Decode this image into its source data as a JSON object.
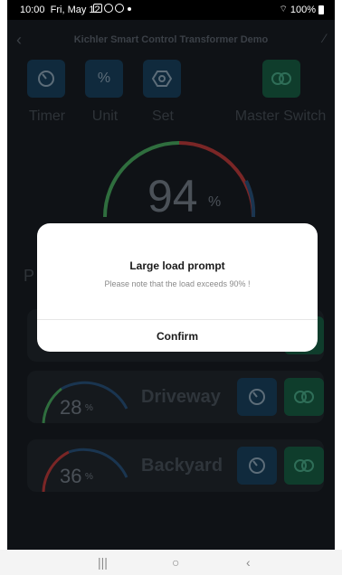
{
  "status_bar": {
    "time": "10:00",
    "date": "Fri, May 12",
    "battery": "100%"
  },
  "header": {
    "title": "Kichler Smart Control Transformer Demo"
  },
  "functions": [
    {
      "label": "Timer",
      "icon": "timer-icon"
    },
    {
      "label": "Unit",
      "icon": "percent-icon"
    },
    {
      "label": "Set",
      "icon": "hexagon-settings-icon"
    },
    {
      "label": "Master Switch",
      "icon": "toggle-icon"
    }
  ],
  "gauge": {
    "value": "94",
    "unit": "%",
    "level_percent": 94
  },
  "section_initial": "P",
  "zones": [
    {
      "name": "Driveway",
      "value": "28",
      "unit": "%",
      "level_percent": 28
    },
    {
      "name": "Backyard",
      "value": "36",
      "unit": "%",
      "level_percent": 36
    }
  ],
  "dialog": {
    "title": "Large load prompt",
    "message": "Please note that the load exceeds 90% !",
    "confirm_label": "Confirm"
  },
  "colors": {
    "timer_tile": "#102a3d",
    "switch_tile": "#0f3d2c",
    "gauge_green": "#2f6e3e",
    "gauge_red": "#7a2626",
    "gauge_blue": "#1a3550"
  }
}
